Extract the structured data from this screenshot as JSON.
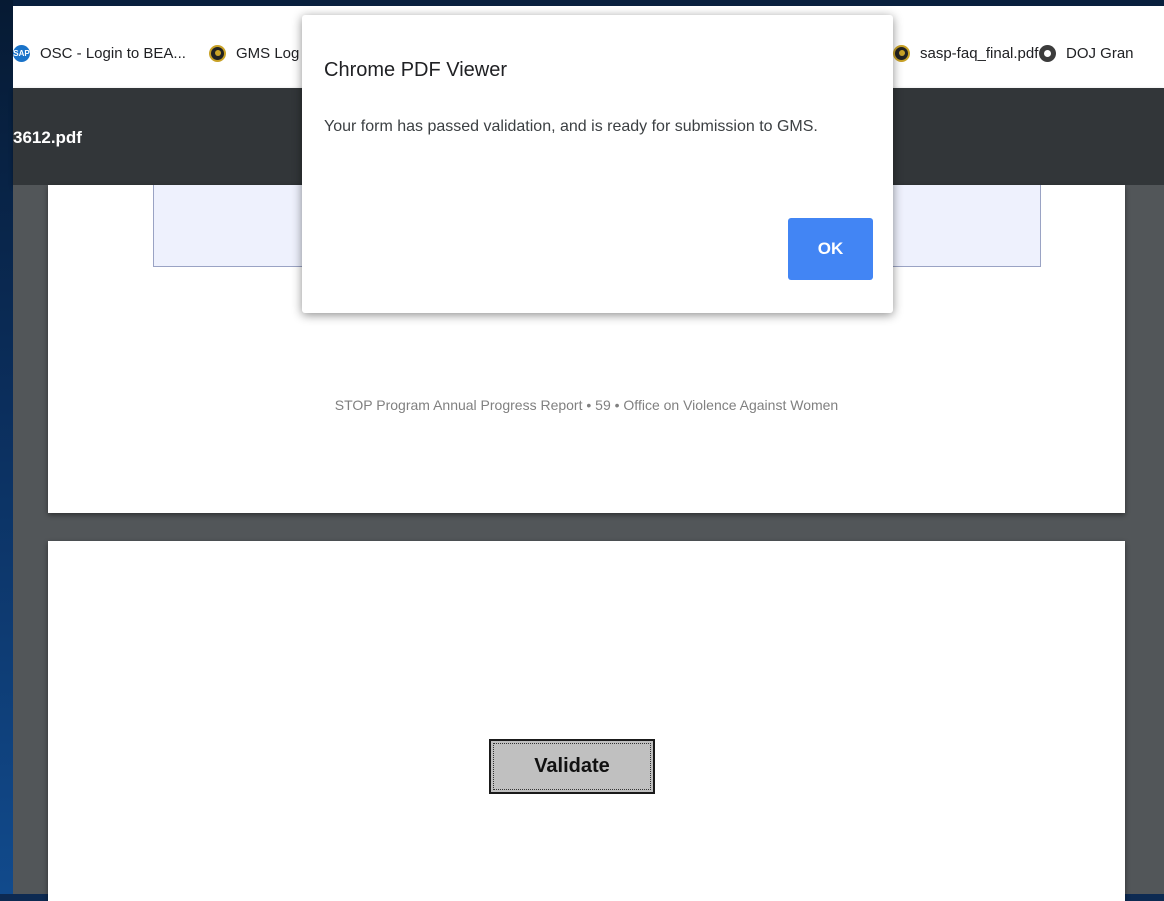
{
  "bookmarks": [
    {
      "label": "OSC - Login to BEA...",
      "icon": "sap-icon"
    },
    {
      "label": "GMS Log",
      "icon": "doj-seal-icon"
    },
    {
      "label": "sasp-faq_final.pdf",
      "icon": "doj-seal-icon"
    },
    {
      "label": "DOJ Gran",
      "icon": "globe-icon"
    }
  ],
  "pdf_toolbar": {
    "title": "3612.pdf"
  },
  "document": {
    "footer": "STOP Program Annual Progress Report • 59 • Office on Violence Against Women",
    "validate_label": "Validate"
  },
  "dialog": {
    "title": "Chrome PDF Viewer",
    "message": "Your form has passed validation, and is ready for submission to GMS.",
    "ok_label": "OK",
    "ok_color": "#4285f4"
  }
}
